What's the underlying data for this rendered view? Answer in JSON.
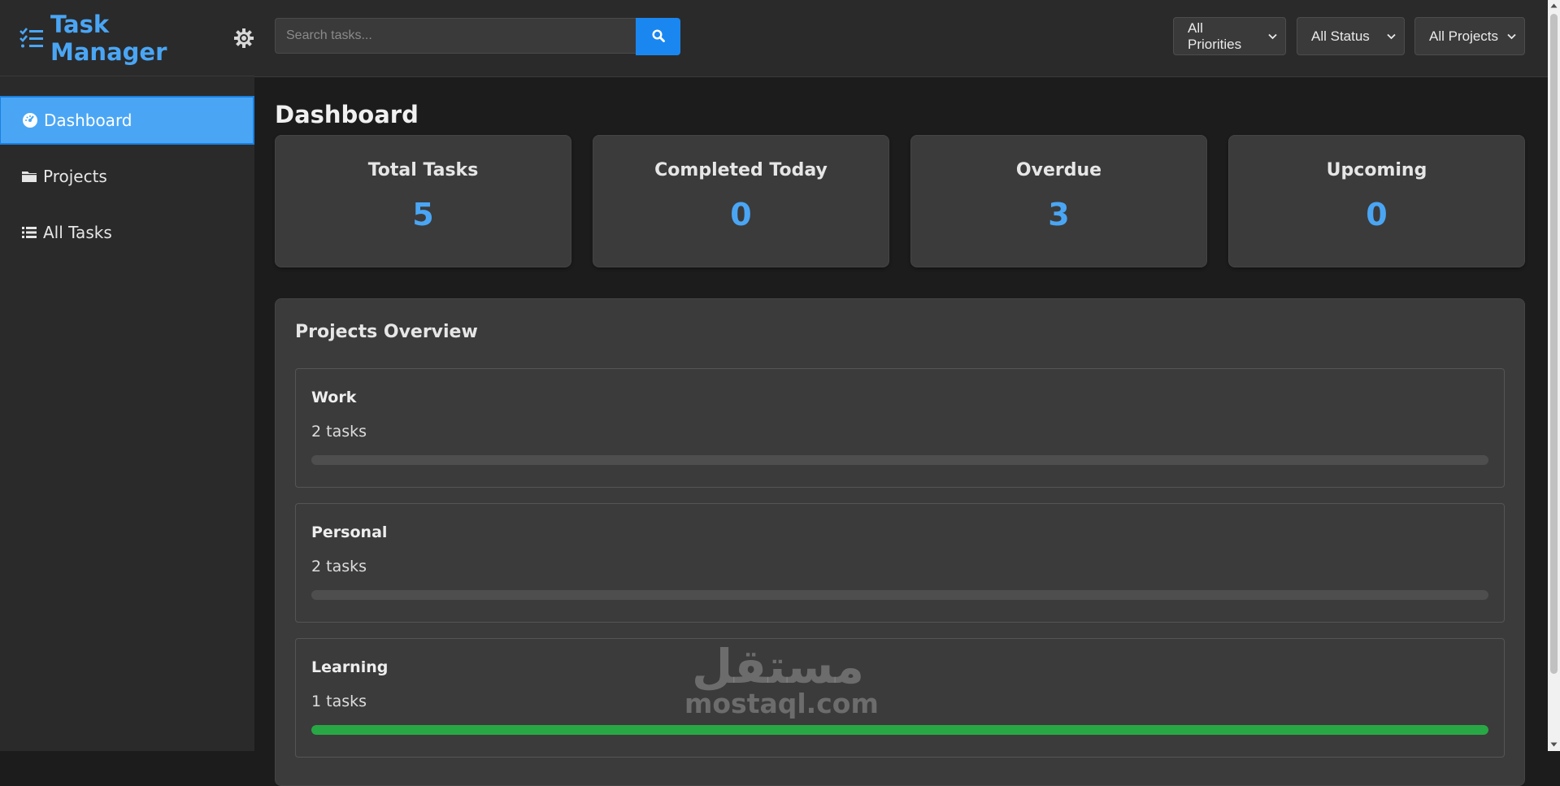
{
  "brand": {
    "title": "Task Manager"
  },
  "sidebar": {
    "items": [
      {
        "label": "Dashboard",
        "icon": "gauge-icon"
      },
      {
        "label": "Projects",
        "icon": "folder-icon"
      },
      {
        "label": "All Tasks",
        "icon": "list-icon"
      }
    ]
  },
  "search": {
    "placeholder": "Search tasks...",
    "value": ""
  },
  "filters": {
    "priority": "All Priorities",
    "status": "All Status",
    "project": "All Projects"
  },
  "page": {
    "title": "Dashboard"
  },
  "stats": [
    {
      "label": "Total Tasks",
      "value": "5"
    },
    {
      "label": "Completed Today",
      "value": "0"
    },
    {
      "label": "Overdue",
      "value": "3"
    },
    {
      "label": "Upcoming",
      "value": "0"
    }
  ],
  "overview": {
    "title": "Projects Overview",
    "projects": [
      {
        "name": "Work",
        "count": "2 tasks",
        "progress": 0
      },
      {
        "name": "Personal",
        "count": "2 tasks",
        "progress": 0
      },
      {
        "name": "Learning",
        "count": "1 tasks",
        "progress": 1
      }
    ]
  },
  "watermark": {
    "arabic": "مستقل",
    "latin": "mostaql.com"
  },
  "colors": {
    "accent": "#4aa6f5",
    "search_button": "#1a87f0",
    "progress": "#28a745"
  }
}
